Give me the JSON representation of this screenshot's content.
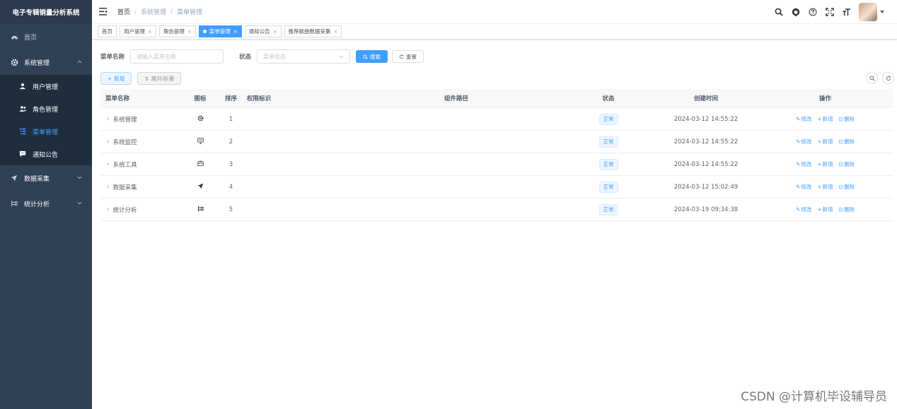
{
  "app": {
    "title": "电子专辑销量分析系统"
  },
  "sidebar": {
    "home": "首页",
    "system": "系统管理",
    "sub": [
      {
        "label": "用户管理",
        "icon": "user-icon",
        "active": false
      },
      {
        "label": "角色管理",
        "icon": "peoples-icon",
        "active": false
      },
      {
        "label": "菜单管理",
        "icon": "tree-table-icon",
        "active": true
      },
      {
        "label": "通知公告",
        "icon": "message-icon",
        "active": false
      }
    ],
    "collect": "数据采集",
    "analysis": "统计分析"
  },
  "navbar": {
    "breadcrumb": [
      "首页",
      "系统管理",
      "菜单管理"
    ]
  },
  "tags": [
    {
      "label": "首页",
      "closable": false,
      "active": false
    },
    {
      "label": "用户管理",
      "closable": true,
      "active": false
    },
    {
      "label": "角色管理",
      "closable": true,
      "active": false
    },
    {
      "label": "菜单管理",
      "closable": true,
      "active": true
    },
    {
      "label": "通知公告",
      "closable": true,
      "active": false
    },
    {
      "label": "推荐歌曲数据采集",
      "closable": true,
      "active": false
    }
  ],
  "search": {
    "name_label": "菜单名称",
    "name_placeholder": "请输入菜单名称",
    "status_label": "状态",
    "status_placeholder": "菜单状态",
    "search_btn": "搜索",
    "reset_btn": "重置"
  },
  "toolbar": {
    "add": "新增",
    "toggle": "展开/折叠"
  },
  "table": {
    "headers": [
      "菜单名称",
      "图标",
      "排序",
      "权限标识",
      "组件路径",
      "状态",
      "创建时间",
      "操作"
    ],
    "rows": [
      {
        "name": "系统管理",
        "icon": "gear-icon",
        "order": "1",
        "perm": "",
        "comp": "",
        "status": "正常",
        "time": "2024-03-12 14:55:22"
      },
      {
        "name": "系统监控",
        "icon": "monitor-icon",
        "order": "2",
        "perm": "",
        "comp": "",
        "status": "正常",
        "time": "2024-03-12 14:55:22"
      },
      {
        "name": "系统工具",
        "icon": "toolbox-icon",
        "order": "3",
        "perm": "",
        "comp": "",
        "status": "正常",
        "time": "2024-03-12 14:55:22"
      },
      {
        "name": "数据采集",
        "icon": "send-icon",
        "order": "4",
        "perm": "",
        "comp": "",
        "status": "正常",
        "time": "2024-03-12 15:02:49"
      },
      {
        "name": "统计分析",
        "icon": "tree-icon",
        "order": "5",
        "perm": "",
        "comp": "",
        "status": "正常",
        "time": "2024-03-19 09:34:38"
      }
    ],
    "ops": {
      "edit": "修改",
      "add": "新增",
      "del": "删除"
    }
  },
  "watermark": "CSDN @计算机毕设辅导员"
}
